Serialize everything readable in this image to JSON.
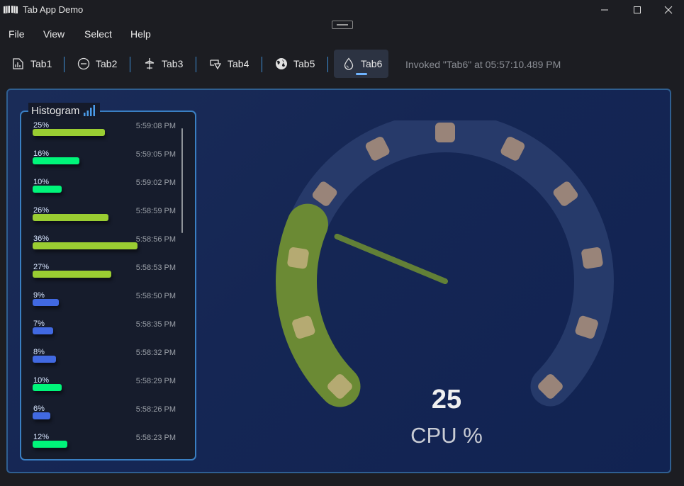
{
  "window": {
    "title": "Tab App Demo",
    "controls": [
      "minimize",
      "maximize",
      "close"
    ]
  },
  "menu": {
    "items": [
      {
        "label": "File"
      },
      {
        "label": "View"
      },
      {
        "label": "Select"
      },
      {
        "label": "Help"
      }
    ]
  },
  "tabs": [
    {
      "label": "Tab1",
      "icon": "document-chart-icon",
      "active": false
    },
    {
      "label": "Tab2",
      "icon": "circle-dash-icon",
      "active": false
    },
    {
      "label": "Tab3",
      "icon": "airplane-icon",
      "active": false
    },
    {
      "label": "Tab4",
      "icon": "shapes-icon",
      "active": false
    },
    {
      "label": "Tab5",
      "icon": "globe-icon",
      "active": false
    },
    {
      "label": "Tab6",
      "icon": "droplet-icon",
      "active": true
    }
  ],
  "status": {
    "text": "Invoked \"Tab6\" at 05:57:10.489 PM"
  },
  "histogram": {
    "title": "Histogram",
    "icon": "signal-bars-icon",
    "rows": [
      {
        "pct": "25%",
        "value": 25,
        "time": "5:59:08 PM",
        "color": "#9acd32"
      },
      {
        "pct": "16%",
        "value": 16,
        "time": "5:59:05 PM",
        "color": "#00f57a"
      },
      {
        "pct": "10%",
        "value": 10,
        "time": "5:59:02 PM",
        "color": "#00f57a"
      },
      {
        "pct": "26%",
        "value": 26,
        "time": "5:58:59 PM",
        "color": "#9acd32"
      },
      {
        "pct": "36%",
        "value": 36,
        "time": "5:58:56 PM",
        "color": "#9acd32"
      },
      {
        "pct": "27%",
        "value": 27,
        "time": "5:58:53 PM",
        "color": "#9acd32"
      },
      {
        "pct": "9%",
        "value": 9,
        "time": "5:58:50 PM",
        "color": "#4169e1"
      },
      {
        "pct": "7%",
        "value": 7,
        "time": "5:58:35 PM",
        "color": "#4169e1"
      },
      {
        "pct": "8%",
        "value": 8,
        "time": "5:58:32 PM",
        "color": "#4169e1"
      },
      {
        "pct": "10%",
        "value": 10,
        "time": "5:58:29 PM",
        "color": "#00f57a"
      },
      {
        "pct": "6%",
        "value": 6,
        "time": "5:58:26 PM",
        "color": "#4169e1"
      },
      {
        "pct": "12%",
        "value": 12,
        "time": "5:58:23 PM",
        "color": "#00f57a"
      }
    ]
  },
  "gauge": {
    "value": "25",
    "label": "CPU %",
    "value_numeric": 25,
    "min": 0,
    "max": 100,
    "fill_color": "#6b8a34",
    "track_color": "#2e4272",
    "tick_color": "#998479"
  }
}
